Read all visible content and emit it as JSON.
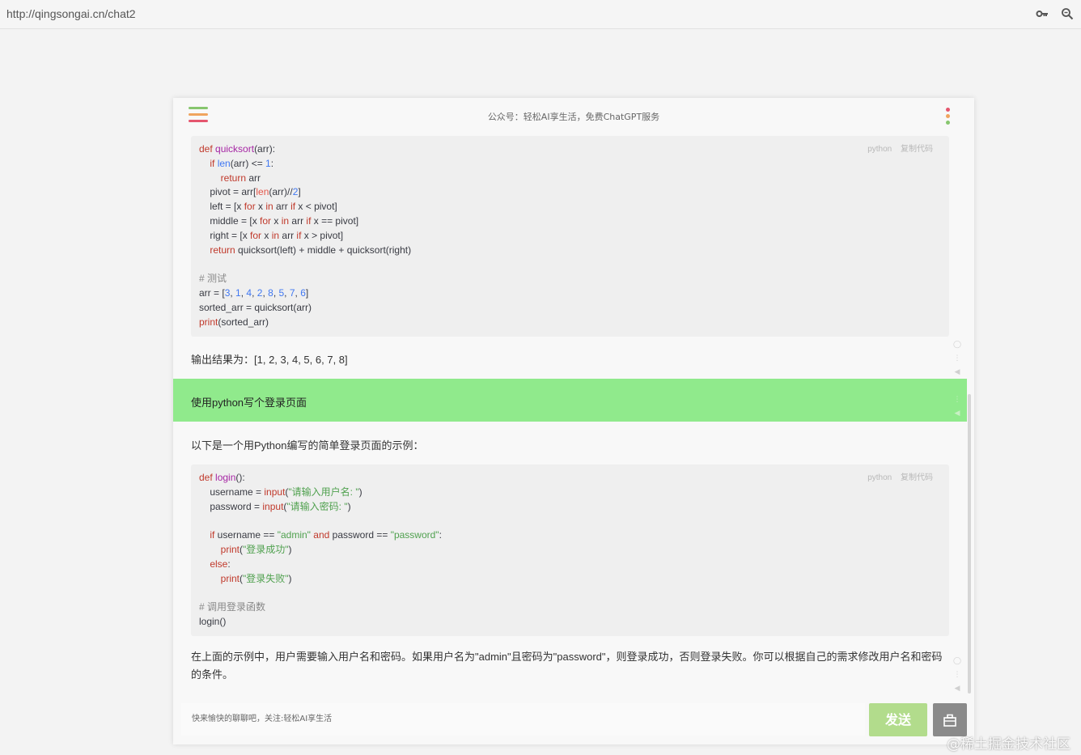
{
  "browser": {
    "url": "http://qingsongai.cn/chat2",
    "icons": [
      "key-icon",
      "zoom-icon"
    ]
  },
  "header": {
    "title": "公众号：轻松AI享生活，免费ChatGPT服务"
  },
  "code_block_1": {
    "lang_label": "python",
    "copy_label": "复制代码"
  },
  "result_text": "输出结果为：[1, 2, 3, 4, 5, 6, 7, 8]",
  "user_message": "使用python写个登录页面",
  "intro_text": "以下是一个用Python编写的简单登录页面的示例：",
  "code_block_2": {
    "lang_label": "python",
    "copy_label": "复制代码"
  },
  "summary_text": "在上面的示例中，用户需要输入用户名和密码。如果用户名为\"admin\"且密码为\"password\"，则登录成功，否则登录失败。你可以根据自己的需求修改用户名和密码的条件。",
  "input": {
    "placeholder": "快来愉快的聊聊吧，关注:轻松AI享生活"
  },
  "send_label": "发送",
  "watermark": "@稀土掘金技术社区",
  "colors": {
    "user_bubble": "#90ea8c",
    "send_button": "#b2dc8c",
    "menu_green": "#87c66e",
    "menu_orange": "#f0a45e",
    "menu_red": "#e5566e"
  }
}
